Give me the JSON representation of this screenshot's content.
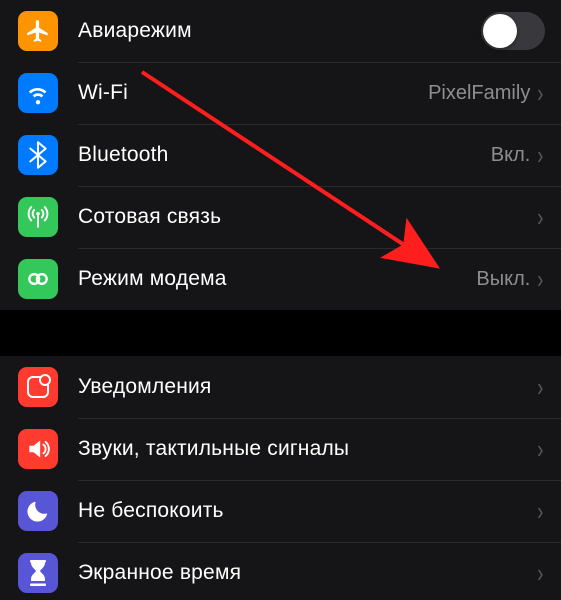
{
  "group1": {
    "items": [
      {
        "label": "Авиарежим",
        "value": null,
        "toggle": false
      },
      {
        "label": "Wi-Fi",
        "value": "PixelFamily"
      },
      {
        "label": "Bluetooth",
        "value": "Вкл."
      },
      {
        "label": "Сотовая связь",
        "value": null
      },
      {
        "label": "Режим модема",
        "value": "Выкл."
      }
    ]
  },
  "group2": {
    "items": [
      {
        "label": "Уведомления"
      },
      {
        "label": "Звуки, тактильные сигналы"
      },
      {
        "label": "Не беспокоить"
      },
      {
        "label": "Экранное время"
      }
    ]
  }
}
